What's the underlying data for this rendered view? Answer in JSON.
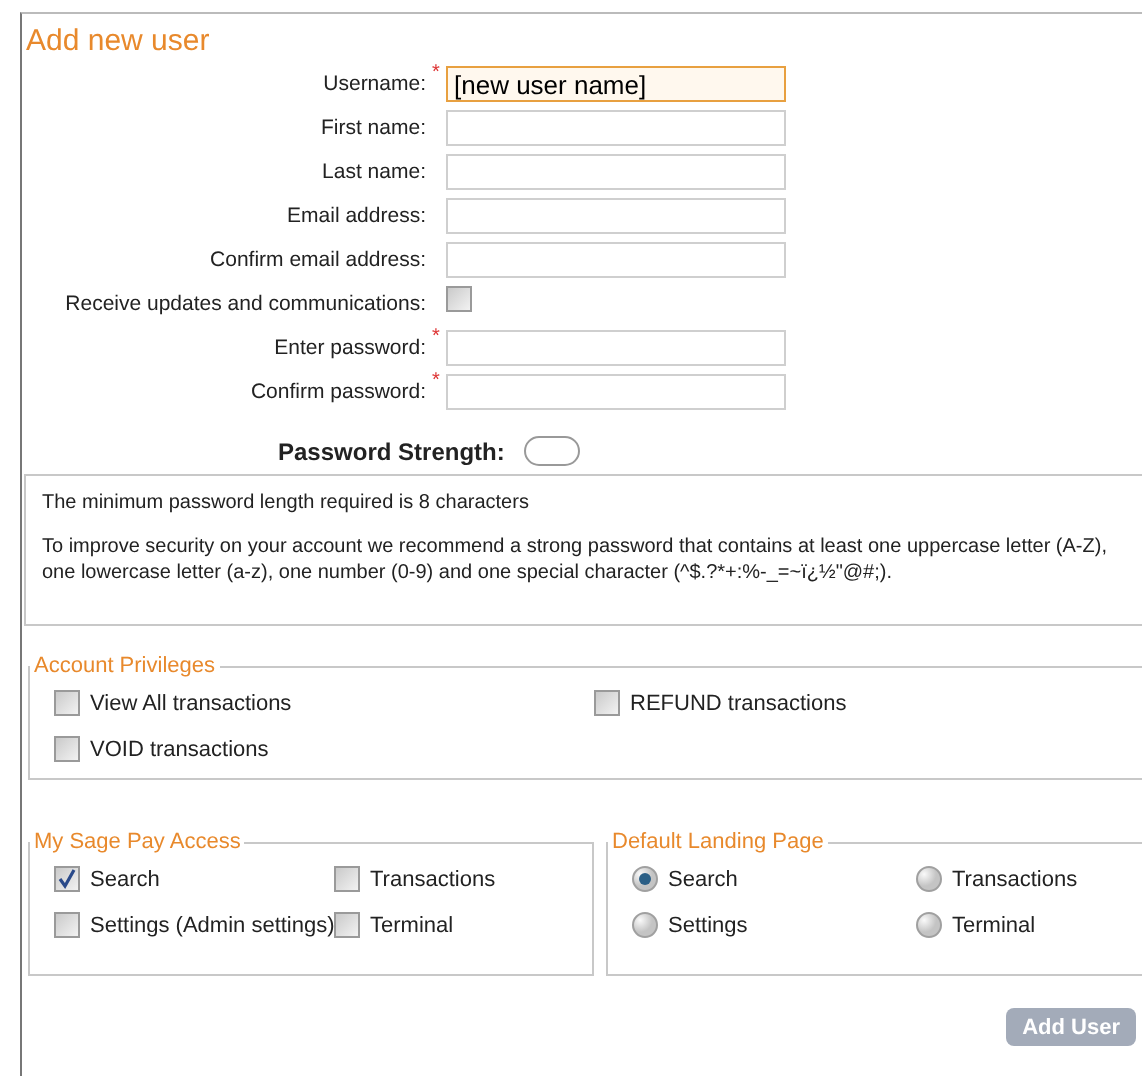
{
  "title": "Add new user",
  "fields": [
    {
      "label": "Username:",
      "kind": "text",
      "required": true,
      "value": "[new user name]",
      "focused": true
    },
    {
      "label": "First name:",
      "kind": "text",
      "required": false,
      "focused": false
    },
    {
      "label": "Last name:",
      "kind": "text",
      "required": false,
      "focused": false
    },
    {
      "label": "Email address:",
      "kind": "text",
      "required": false,
      "focused": false
    },
    {
      "label": "Confirm email address:",
      "kind": "text",
      "required": false,
      "focused": false
    },
    {
      "label": "Receive updates and communications:",
      "kind": "checkbox",
      "required": false,
      "checked": false
    },
    {
      "label": "Enter password:",
      "kind": "text",
      "required": true,
      "focused": false
    },
    {
      "label": "Confirm password:",
      "kind": "text",
      "required": true,
      "focused": false
    }
  ],
  "required_mark": "*",
  "password_strength": {
    "label": "Password Strength:"
  },
  "info": [
    "The minimum password length required is 8 characters",
    "To improve security on your account we recommend a strong password that contains at least one uppercase letter (A-Z), one lowercase letter (a-z), one number (0-9) and one special character (^$.?*+:%-_=~ï¿½\"@#;)."
  ],
  "account_privileges": {
    "legend": "Account Privileges",
    "items": [
      {
        "label": "View All transactions",
        "checked": false
      },
      {
        "label": "REFUND transactions",
        "checked": false
      },
      {
        "label": "VOID transactions",
        "checked": false
      }
    ]
  },
  "my_sage_pay_access": {
    "legend": "My Sage Pay Access",
    "items": [
      {
        "label": "Search",
        "checked": true
      },
      {
        "label": "Transactions",
        "checked": false
      },
      {
        "label": "Settings (Admin settings)",
        "checked": false
      },
      {
        "label": "Terminal",
        "checked": false
      }
    ]
  },
  "default_landing_page": {
    "legend": "Default Landing Page",
    "items": [
      {
        "label": "Search",
        "selected": true
      },
      {
        "label": "Transactions",
        "selected": false
      },
      {
        "label": "Settings",
        "selected": false
      },
      {
        "label": "Terminal",
        "selected": false
      }
    ]
  },
  "add_button": {
    "label": "Add User",
    "disabled": true
  }
}
